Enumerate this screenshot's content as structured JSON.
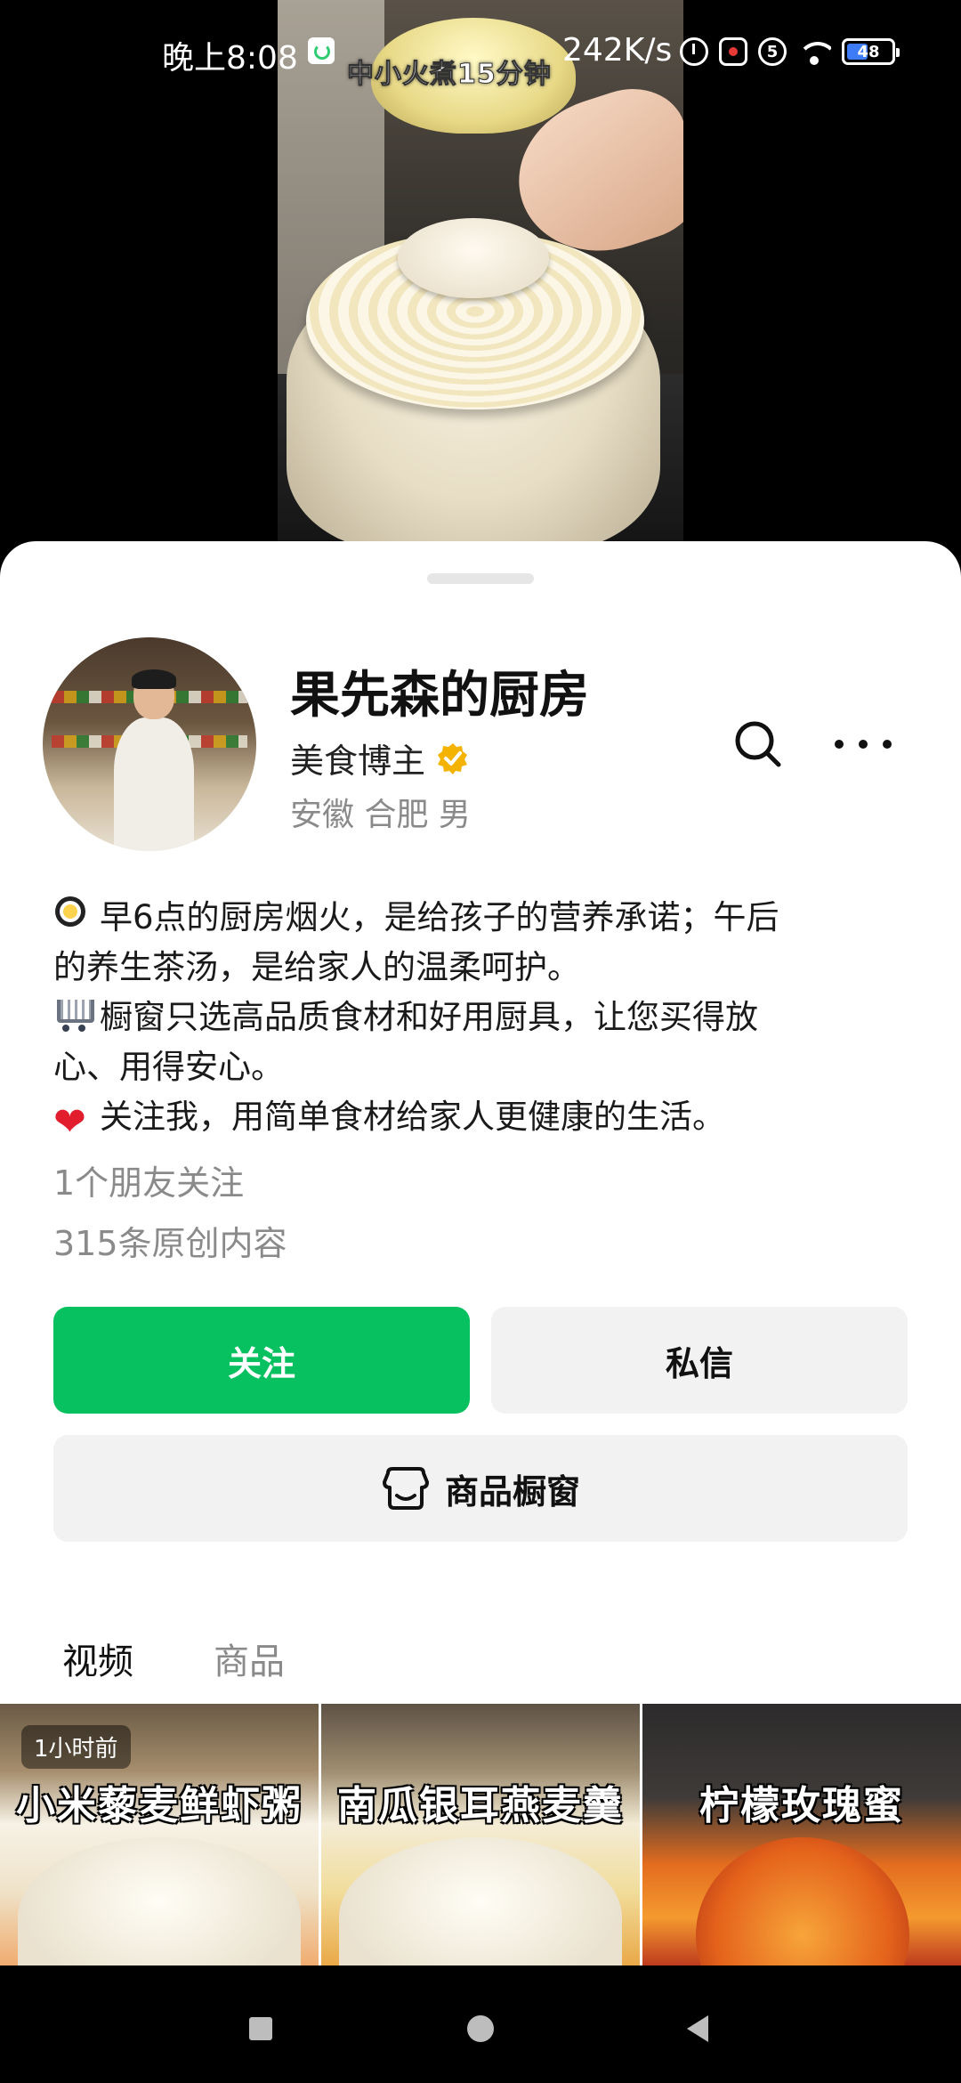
{
  "status_bar": {
    "time": "晚上8:08",
    "net_speed": "242K/s",
    "battery": "48",
    "battery_level": 0.48,
    "notification_count": "5"
  },
  "video": {
    "caption": "中小火煮15分钟"
  },
  "profile": {
    "name": "果先森的厨房",
    "role": "美食博主",
    "location": "安徽 合肥 男",
    "bio_lines": [
      "早6点的厨房烟火，是给孩子的营养承诺；午后",
      "的养生茶汤，是给家人的温柔呵护。",
      "橱窗只选高品质食材和好用厨具，让您买得放",
      "心、用得安心。",
      "关注我，用简单食材给家人更健康的生活。"
    ],
    "friends_following": "1个朋友关注",
    "original_count": "315条原创内容"
  },
  "actions": {
    "follow": "关注",
    "message": "私信",
    "shop": "商品橱窗"
  },
  "tabs": [
    {
      "label": "视频",
      "active": true
    },
    {
      "label": "商品",
      "active": false
    }
  ],
  "videos": [
    {
      "badge": "1小时前",
      "title": "小米藜麦鲜虾粥"
    },
    {
      "badge": "",
      "title": "南瓜银耳燕麦羹"
    },
    {
      "badge": "",
      "title": "柠檬玫瑰蜜"
    }
  ],
  "colors": {
    "follow_button": "#07c160",
    "verified_badge": "#f5b301",
    "battery_fill": "#3d7bf7"
  }
}
